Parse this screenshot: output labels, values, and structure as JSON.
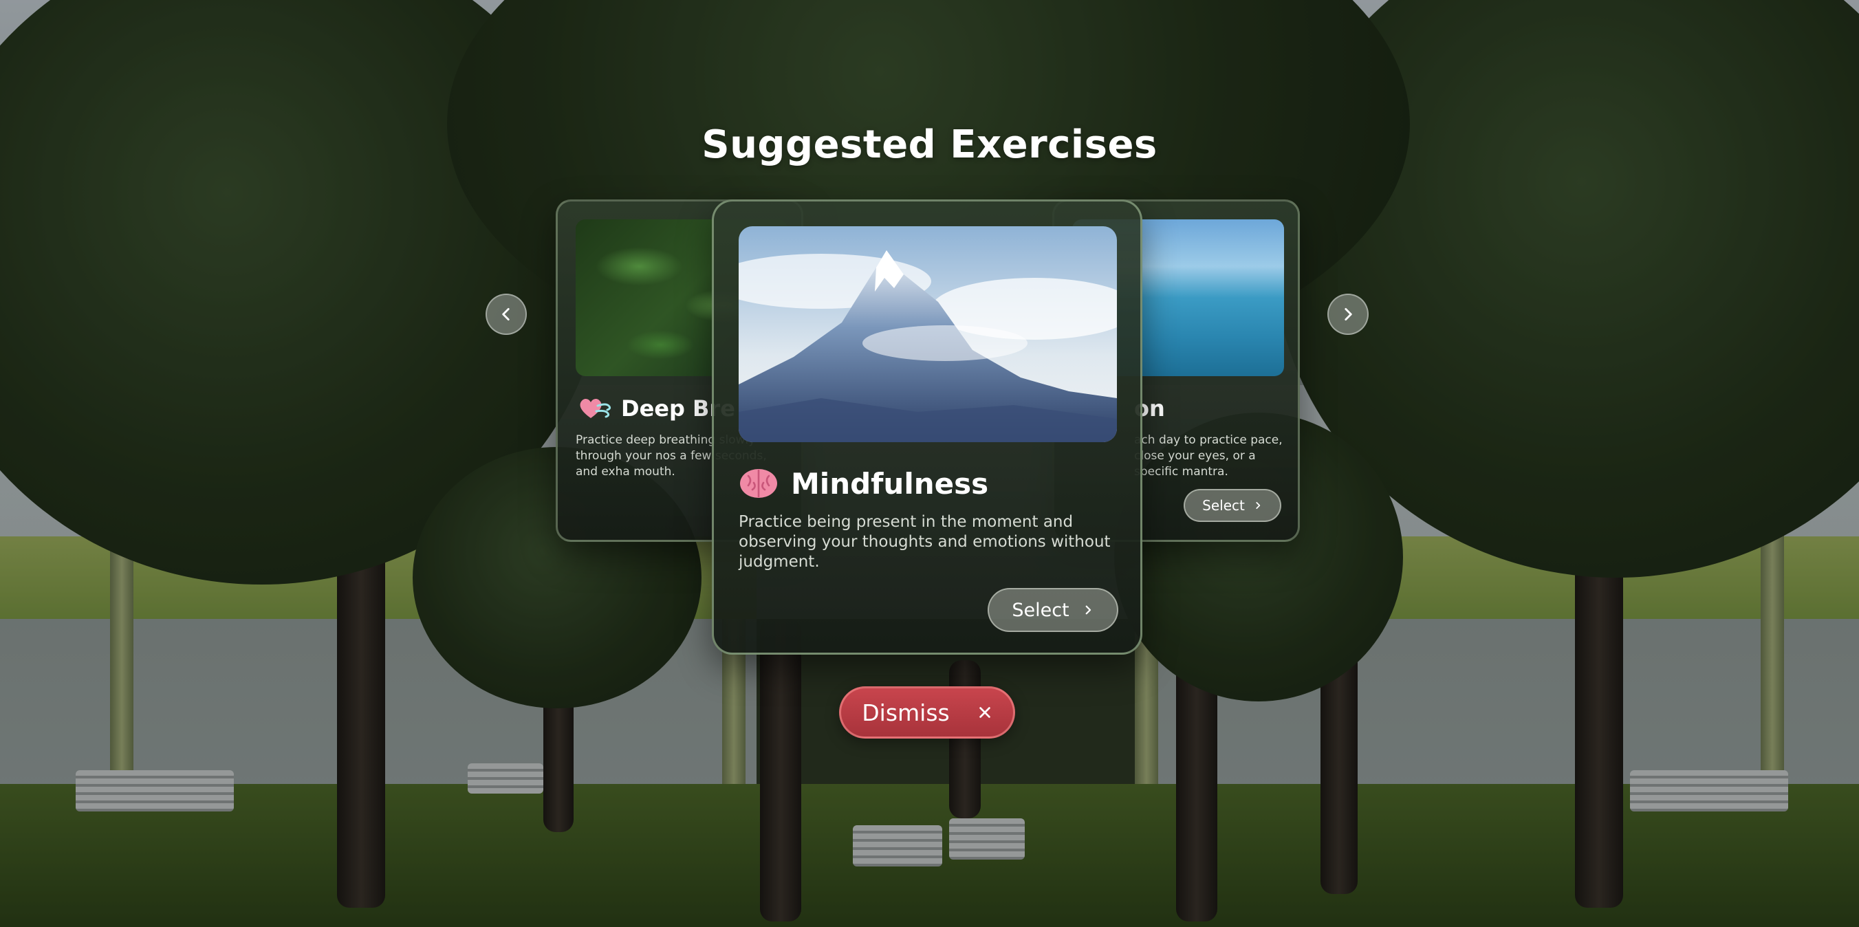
{
  "header": {
    "title": "Suggested Exercises"
  },
  "carousel": {
    "prev_icon": "chevron-left-icon",
    "next_icon": "chevron-right-icon",
    "cards": [
      {
        "id": "deep-breathing",
        "title": "Deep Bre",
        "icon": "heart-breath-icon",
        "description": "Practice deep breathing slowly through your nos a few seconds, and exha mouth.",
        "image": "green leaves"
      },
      {
        "id": "mindfulness",
        "title": "Mindfulness",
        "icon": "brain-icon",
        "description": "Practice being present in the moment and observing your thoughts and emotions without judgment.",
        "image": "snowy mountain peak",
        "select_label": "Select"
      },
      {
        "id": "meditation",
        "title": "on",
        "description": "ach day to practice pace, close your eyes, or a specific mantra.",
        "image": "ocean horizon",
        "select_label": "Select"
      }
    ]
  },
  "dismiss": {
    "label": "Dismiss",
    "icon": "close-icon"
  },
  "colors": {
    "dismiss": "#b83d45",
    "card_bg": "#232b22",
    "brand_text": "#ffffff"
  }
}
